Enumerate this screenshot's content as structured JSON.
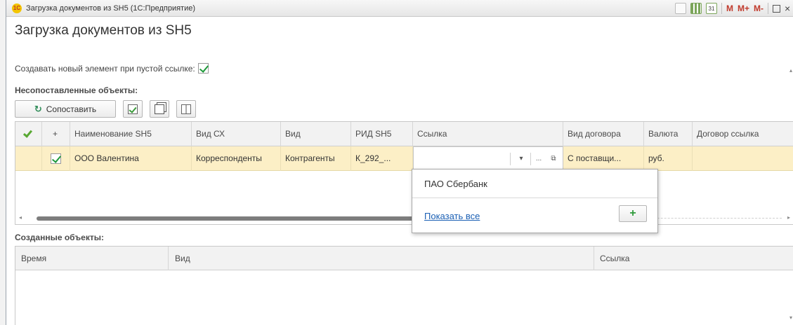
{
  "window": {
    "title": "Загрузка документов из SH5  (1С:Предприятие)",
    "app_icon_text": "1С",
    "toolbar_calendar_label": "31",
    "memory_buttons": [
      "M",
      "M+",
      "M-"
    ],
    "close_glyph": "×"
  },
  "form": {
    "title": "Загрузка документов из SH5",
    "option_label": "Создавать новый элемент при пустой ссылке:",
    "option_checked": true
  },
  "unmatched": {
    "label": "Несопоставленные объекты:",
    "buttons": {
      "match_label": "Сопоставить",
      "match_icon": "↻"
    },
    "columns": [
      "",
      "+",
      "Наименование SH5",
      "Вид СХ",
      "Вид",
      "РИД SH5",
      "Ссылка",
      "Вид договора",
      "Валюта",
      "Договор ссылка"
    ],
    "rows": [
      {
        "checked": true,
        "name": "ООО Валентина",
        "vid_sx": "Корреспонденты",
        "vid": "Контрагенты",
        "rid": "К_292_...",
        "link": "",
        "contract_type": "С поставщи...",
        "currency": "руб.",
        "contract_link": ""
      }
    ],
    "link_cell_buttons": [
      "▾",
      "...",
      "⧉"
    ]
  },
  "dropdown": {
    "items": [
      "ПАО Сбербанк"
    ],
    "show_all_label": "Показать все",
    "add_label": "+"
  },
  "created": {
    "label": "Созданные объекты:",
    "columns": [
      "Время",
      "Вид",
      "Ссылка"
    ]
  },
  "colors": {
    "row_highlight": "#fcefc6",
    "header_bg": "#f2f2f2",
    "link_blue": "#1a5fb4",
    "check_green": "#1e9a3a"
  }
}
